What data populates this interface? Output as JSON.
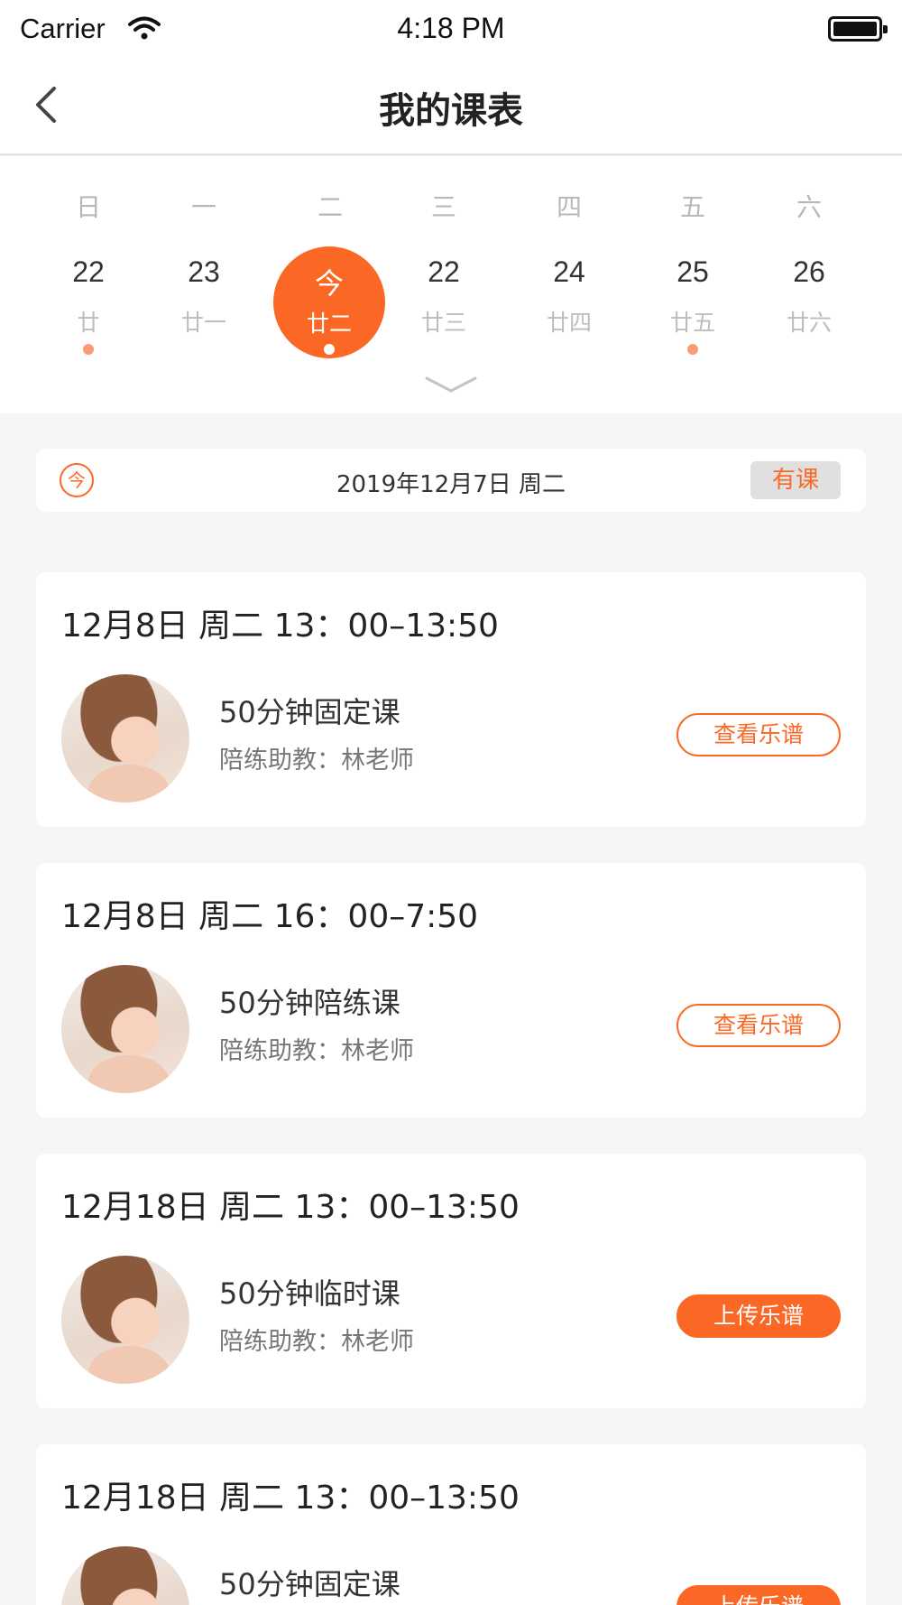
{
  "status_bar": {
    "carrier": "Carrier",
    "time": "4:18 PM"
  },
  "nav": {
    "title": "我的课表",
    "back_icon": "chevron-left-icon"
  },
  "calendar": {
    "days": [
      {
        "weekday": "日",
        "date": "22",
        "lunar": "廿",
        "has_class": true,
        "today": false
      },
      {
        "weekday": "一",
        "date": "23",
        "lunar": "廿一",
        "has_class": false,
        "today": false
      },
      {
        "weekday": "二",
        "date": "今",
        "lunar": "廿二",
        "has_class": true,
        "today": true
      },
      {
        "weekday": "三",
        "date": "22",
        "lunar": "廿三",
        "has_class": false,
        "today": false
      },
      {
        "weekday": "四",
        "date": "24",
        "lunar": "廿四",
        "has_class": false,
        "today": false
      },
      {
        "weekday": "五",
        "date": "25",
        "lunar": "廿五",
        "has_class": true,
        "today": false
      },
      {
        "weekday": "六",
        "date": "26",
        "lunar": "廿六",
        "has_class": false,
        "today": false
      }
    ],
    "accent_color": "#fb6825",
    "dot_color": "#fb9b73"
  },
  "banner": {
    "today_icon_text": "今",
    "date_text": "2019年12月7日   周二",
    "status_badge": "有课"
  },
  "lessons": [
    {
      "time": "12月8日   周二    13：00–13:50",
      "name": "50分钟固定课",
      "teacher": "陪练助教：林老师",
      "action": "查看乐谱",
      "action_style": "outline"
    },
    {
      "time": "12月8日   周二    16：00–7:50",
      "name": "50分钟陪练课",
      "teacher": "陪练助教：林老师",
      "action": "查看乐谱",
      "action_style": "outline"
    },
    {
      "time": "12月18日   周二    13：00–13:50",
      "name": "50分钟临时课",
      "teacher": "陪练助教：林老师",
      "action": "上传乐谱",
      "action_style": "solid"
    },
    {
      "time": "12月18日   周二    13：00–13:50",
      "name": "50分钟固定课",
      "teacher": "",
      "action": "上传乐谱",
      "action_style": "solid"
    }
  ]
}
